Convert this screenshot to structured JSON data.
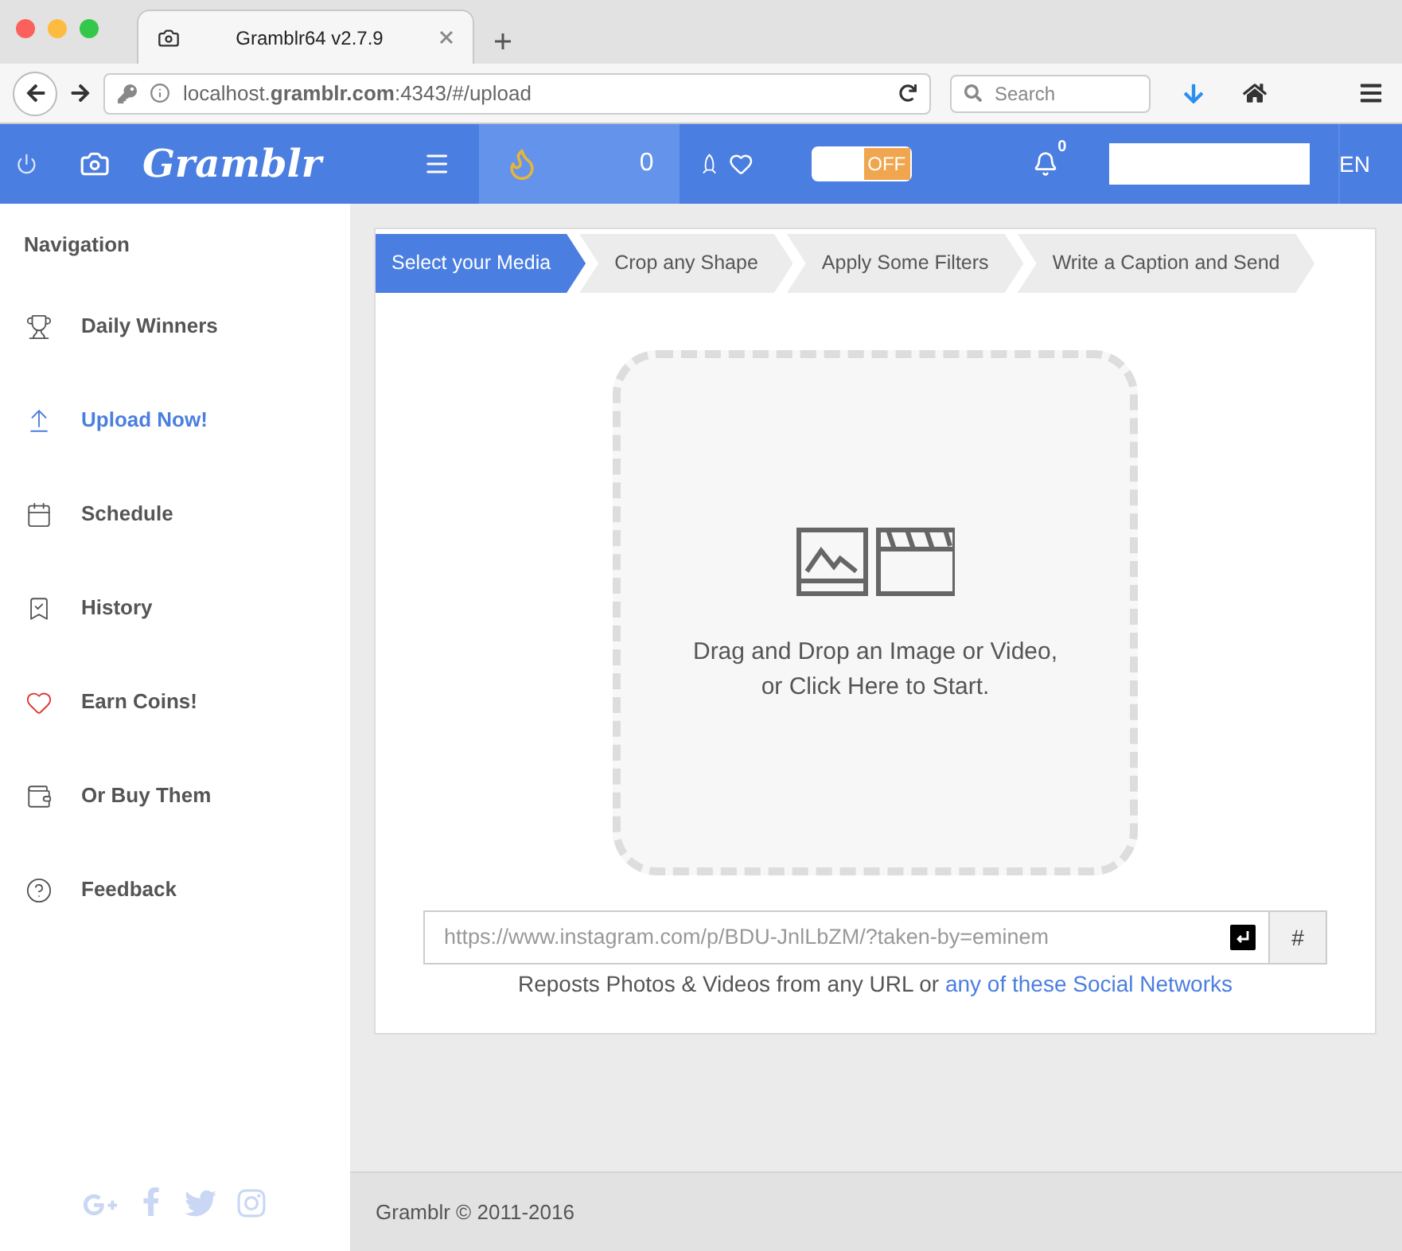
{
  "browser": {
    "tab_title": "Gramblr64 v2.7.9",
    "url": "localhost.**gramblr.com**:4343/#/upload",
    "search_placeholder": "Search"
  },
  "header": {
    "brand": "Gramblr",
    "coins": "0",
    "toggle": {
      "label": "OFF",
      "on": false
    },
    "notifications": "0",
    "language": "EN"
  },
  "sidebar": {
    "title": "Navigation",
    "items": [
      {
        "label": "Daily Winners",
        "selected": false
      },
      {
        "label": "Upload Now!",
        "selected": true
      },
      {
        "label": "Schedule",
        "selected": false
      },
      {
        "label": "History",
        "selected": false
      },
      {
        "label": "Earn Coins!",
        "selected": false
      },
      {
        "label": "Or Buy Them",
        "selected": false
      },
      {
        "label": "Feedback",
        "selected": false
      }
    ]
  },
  "steps": [
    {
      "label": "Select your Media",
      "selected": true
    },
    {
      "label": "Crop any Shape",
      "selected": false
    },
    {
      "label": "Apply Some Filters",
      "selected": false
    },
    {
      "label": "Write a Caption and Send",
      "selected": false
    }
  ],
  "dropzone": {
    "lines": [
      "Drag and Drop an Image or Video,",
      "or Click Here to Start."
    ]
  },
  "url_input": {
    "placeholder": "https://www.instagram.com/p/BDU-JnlLbZM/?taken-by=eminem",
    "hash_button": "#"
  },
  "note": {
    "text": "Reposts Photos & Videos from any URL or",
    "link": "any of these Social Networks"
  },
  "footer": "Gramblr © 2011-2016"
}
